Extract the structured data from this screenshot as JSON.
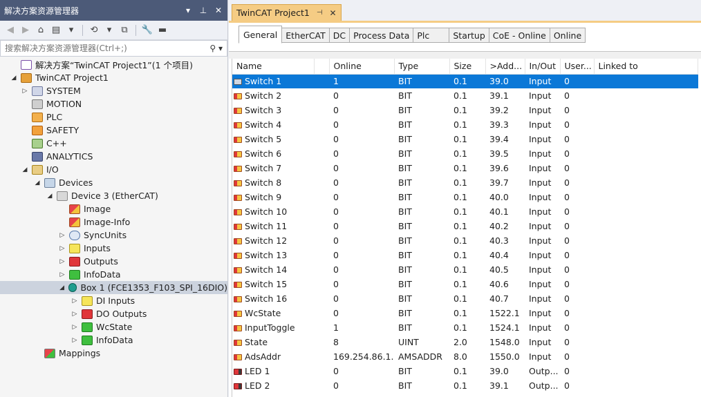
{
  "explorer": {
    "title": "解决方案资源管理器",
    "search_placeholder": "搜索解决方案资源管理器(Ctrl+;)",
    "tree": [
      {
        "label": "解决方案“TwinCAT Project1”(1 个项目)"
      },
      {
        "label": "TwinCAT Project1"
      },
      {
        "label": "SYSTEM"
      },
      {
        "label": "MOTION"
      },
      {
        "label": "PLC"
      },
      {
        "label": "SAFETY"
      },
      {
        "label": "C++"
      },
      {
        "label": "ANALYTICS"
      },
      {
        "label": "I/O"
      },
      {
        "label": "Devices"
      },
      {
        "label": "Device 3 (EtherCAT)"
      },
      {
        "label": "Image"
      },
      {
        "label": "Image-Info"
      },
      {
        "label": "SyncUnits"
      },
      {
        "label": "Inputs"
      },
      {
        "label": "Outputs"
      },
      {
        "label": "InfoData"
      },
      {
        "label": "Box 1 (FCE1353_F103_SPI_16DIO)"
      },
      {
        "label": "DI Inputs"
      },
      {
        "label": "DO Outputs"
      },
      {
        "label": "WcState"
      },
      {
        "label": "InfoData"
      },
      {
        "label": "Mappings"
      }
    ]
  },
  "document_tab": {
    "label": "TwinCAT Project1"
  },
  "property_tabs": [
    "General",
    "EtherCAT",
    "DC",
    "Process Data",
    "Plc",
    "Startup",
    "CoE - Online",
    "Online"
  ],
  "grid": {
    "columns": [
      "Name",
      "",
      "Online",
      "Type",
      "Size",
      ">Add...",
      "In/Out",
      "User...",
      "Linked to"
    ],
    "rows": [
      {
        "name": "Switch 1",
        "online": "1",
        "type": "BIT",
        "size": "0.1",
        "addr": "39.0",
        "inout": "Input",
        "user": "0"
      },
      {
        "name": "Switch 2",
        "online": "0",
        "type": "BIT",
        "size": "0.1",
        "addr": "39.1",
        "inout": "Input",
        "user": "0"
      },
      {
        "name": "Switch 3",
        "online": "0",
        "type": "BIT",
        "size": "0.1",
        "addr": "39.2",
        "inout": "Input",
        "user": "0"
      },
      {
        "name": "Switch 4",
        "online": "0",
        "type": "BIT",
        "size": "0.1",
        "addr": "39.3",
        "inout": "Input",
        "user": "0"
      },
      {
        "name": "Switch 5",
        "online": "0",
        "type": "BIT",
        "size": "0.1",
        "addr": "39.4",
        "inout": "Input",
        "user": "0"
      },
      {
        "name": "Switch 6",
        "online": "0",
        "type": "BIT",
        "size": "0.1",
        "addr": "39.5",
        "inout": "Input",
        "user": "0"
      },
      {
        "name": "Switch 7",
        "online": "0",
        "type": "BIT",
        "size": "0.1",
        "addr": "39.6",
        "inout": "Input",
        "user": "0"
      },
      {
        "name": "Switch 8",
        "online": "0",
        "type": "BIT",
        "size": "0.1",
        "addr": "39.7",
        "inout": "Input",
        "user": "0"
      },
      {
        "name": "Switch 9",
        "online": "0",
        "type": "BIT",
        "size": "0.1",
        "addr": "40.0",
        "inout": "Input",
        "user": "0"
      },
      {
        "name": "Switch 10",
        "online": "0",
        "type": "BIT",
        "size": "0.1",
        "addr": "40.1",
        "inout": "Input",
        "user": "0"
      },
      {
        "name": "Switch 11",
        "online": "0",
        "type": "BIT",
        "size": "0.1",
        "addr": "40.2",
        "inout": "Input",
        "user": "0"
      },
      {
        "name": "Switch 12",
        "online": "0",
        "type": "BIT",
        "size": "0.1",
        "addr": "40.3",
        "inout": "Input",
        "user": "0"
      },
      {
        "name": "Switch 13",
        "online": "0",
        "type": "BIT",
        "size": "0.1",
        "addr": "40.4",
        "inout": "Input",
        "user": "0"
      },
      {
        "name": "Switch 14",
        "online": "0",
        "type": "BIT",
        "size": "0.1",
        "addr": "40.5",
        "inout": "Input",
        "user": "0"
      },
      {
        "name": "Switch 15",
        "online": "0",
        "type": "BIT",
        "size": "0.1",
        "addr": "40.6",
        "inout": "Input",
        "user": "0"
      },
      {
        "name": "Switch 16",
        "online": "0",
        "type": "BIT",
        "size": "0.1",
        "addr": "40.7",
        "inout": "Input",
        "user": "0"
      },
      {
        "name": "WcState",
        "online": "0",
        "type": "BIT",
        "size": "0.1",
        "addr": "1522.1",
        "inout": "Input",
        "user": "0"
      },
      {
        "name": "InputToggle",
        "online": "1",
        "type": "BIT",
        "size": "0.1",
        "addr": "1524.1",
        "inout": "Input",
        "user": "0"
      },
      {
        "name": "State",
        "online": "8",
        "type": "UINT",
        "size": "2.0",
        "addr": "1548.0",
        "inout": "Input",
        "user": "0"
      },
      {
        "name": "AdsAddr",
        "online": "169.254.86.1...",
        "type": "AMSADDR",
        "size": "8.0",
        "addr": "1550.0",
        "inout": "Input",
        "user": "0"
      },
      {
        "name": "LED 1",
        "online": "0",
        "type": "BIT",
        "size": "0.1",
        "addr": "39.0",
        "inout": "Outp...",
        "user": "0"
      },
      {
        "name": "LED 2",
        "online": "0",
        "type": "BIT",
        "size": "0.1",
        "addr": "39.1",
        "inout": "Outp...",
        "user": "0"
      }
    ]
  }
}
